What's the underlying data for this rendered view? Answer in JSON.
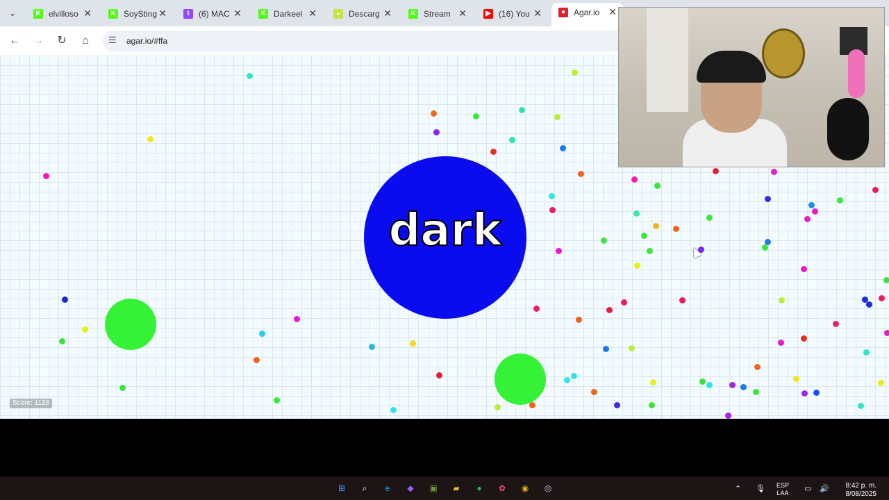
{
  "browser": {
    "tab_menu_icon": "chevron-down-icon",
    "tabs": [
      {
        "label": "elvilloso",
        "icon": "kick-icon",
        "color": "#53fc18",
        "glyph": "K"
      },
      {
        "label": "SoySting",
        "icon": "kick-icon",
        "color": "#53fc18",
        "glyph": "K"
      },
      {
        "label": "(6) MAC",
        "icon": "twitch-icon",
        "color": "#9146ff",
        "glyph": "t"
      },
      {
        "label": "Darkeel",
        "icon": "kick-icon",
        "color": "#53fc18",
        "glyph": "K"
      },
      {
        "label": "Descarg",
        "icon": "download-site-icon",
        "color": "#c8e04a",
        "glyph": "◒"
      },
      {
        "label": "Stream",
        "icon": "kick-icon",
        "color": "#53fc18",
        "glyph": "K"
      },
      {
        "label": "(16) You",
        "icon": "youtube-icon",
        "color": "#ff0000",
        "glyph": "▶"
      },
      {
        "label": "Agar.io",
        "icon": "agar-icon",
        "color": "#e0202e",
        "glyph": "●",
        "active": true
      }
    ],
    "close_glyph": "✕",
    "url": "agar.io/#ffa"
  },
  "game": {
    "player_name": "dark",
    "score_text": "Score: 1128",
    "player_color": "#0b0bf0",
    "virus_color": "#36f236"
  },
  "taskbar": {
    "apps": [
      "windows-start-icon",
      "search-icon",
      "edge-icon",
      "copilot-icon",
      "minecraft-icon",
      "file-explorer-icon",
      "spotify-icon",
      "app-icon",
      "chrome-icon",
      "obs-icon"
    ],
    "lang_line1": "ESP",
    "lang_line2": "LAA",
    "time": "8:42 p. m.",
    "date": "8/08/2025"
  }
}
